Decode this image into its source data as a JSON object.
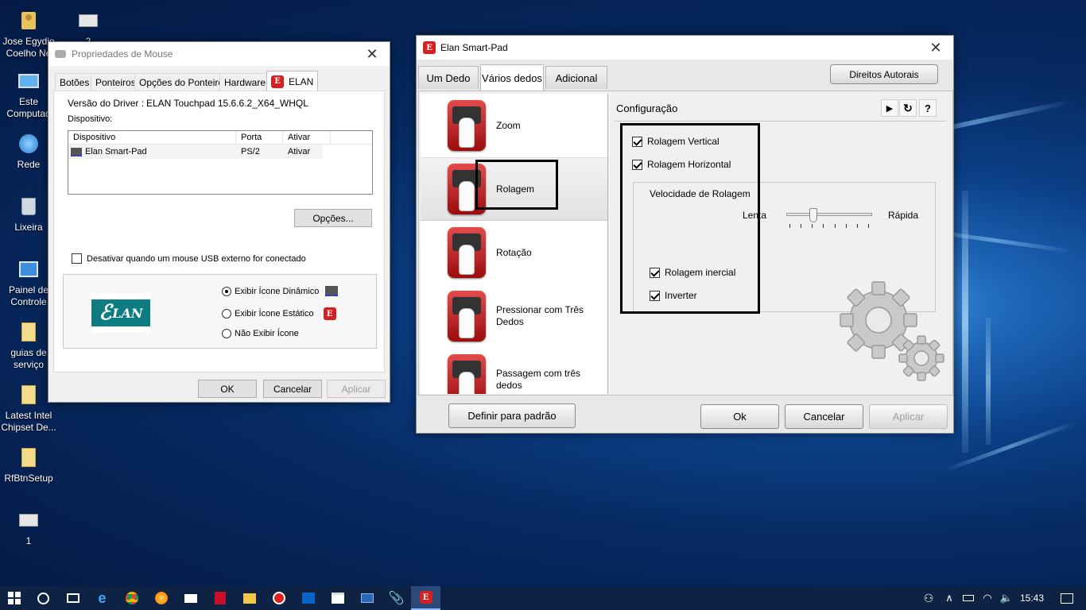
{
  "desktop": {
    "icons": [
      {
        "label": "Jose Egydio Coelho Ne",
        "icon": "user-folder-icon"
      },
      {
        "label": "2",
        "icon": "document-icon"
      },
      {
        "label": "Este Computad",
        "icon": "computer-icon"
      },
      {
        "label": "Rede",
        "icon": "network-icon"
      },
      {
        "label": "Lixeira",
        "icon": "recycle-bin-icon"
      },
      {
        "label": "Painel de Controle",
        "icon": "control-panel-icon"
      },
      {
        "label": "guias de serviço",
        "icon": "folder-icon"
      },
      {
        "label": "Latest Intel Chipset De...",
        "icon": "folder-icon"
      },
      {
        "label": "RfBtnSetup",
        "icon": "folder-icon"
      },
      {
        "label": "1",
        "icon": "document-icon"
      }
    ]
  },
  "mouse_props": {
    "title": "Propriedades de Mouse",
    "tabs": [
      "Botões",
      "Ponteiros",
      "Opções do Ponteiro",
      "Hardware",
      "ELAN"
    ],
    "active_tab": "ELAN",
    "driver_label": "Versão do Driver :",
    "driver_value": "ELAN Touchpad 15.6.6.2_X64_WHQL",
    "device_section": "Dispositivo:",
    "columns": [
      "Dispositivo",
      "Porta",
      "Ativar"
    ],
    "rows": [
      {
        "device": "Elan Smart-Pad",
        "port": "PS/2",
        "status": "Ativar"
      }
    ],
    "options_button": "Opções...",
    "disable_usb": {
      "label": "Desativar quando um mouse USB externo for conectado",
      "checked": false
    },
    "logo_text": "LAN",
    "icon_options": [
      {
        "label": "Exibir Ícone Dinâmico",
        "selected": true
      },
      {
        "label": "Exibir Ícone Estático",
        "selected": false
      },
      {
        "label": "Não Exibir Ícone",
        "selected": false
      }
    ],
    "ok": "OK",
    "cancel": "Cancelar",
    "apply": "Aplicar"
  },
  "elan": {
    "title": "Elan Smart-Pad",
    "tabs": [
      "Um Dedo",
      "Vários dedos",
      "Adicional"
    ],
    "active_tab": "Vários dedos",
    "copyright_button": "Direitos Autorais",
    "gestures": [
      "Zoom",
      "Rolagem",
      "Rotação",
      "Pressionar com Três Dedos",
      "Passagem com três dedos"
    ],
    "selected_gesture": "Rolagem",
    "config_title": "Configuração",
    "vertical_scroll": {
      "label": "Rolagem Vertical",
      "checked": true
    },
    "horizontal_scroll": {
      "label": "Rolagem Horizontal",
      "checked": true
    },
    "speed_group": "Velocidade de Rolagem",
    "slow": "Lenta",
    "fast": "Rápida",
    "speed_level": 0.3,
    "inertial": {
      "label": "Rolagem inercial",
      "checked": true
    },
    "invert": {
      "label": "Inverter",
      "checked": true
    },
    "default_button": "Definir para padrão",
    "ok": "Ok",
    "cancel": "Cancelar",
    "apply": "Aplicar",
    "accent": "#d42020"
  },
  "taskbar": {
    "time": "15:43",
    "apps": [
      "start-icon",
      "search-icon",
      "task-view-icon",
      "edge-icon",
      "chrome-icon",
      "firefox-icon",
      "mail-icon",
      "acrobat-icon",
      "explorer-icon",
      "app-icon",
      "outlook-icon",
      "store-icon",
      "powershell-icon",
      "attachment-icon",
      "elan-icon"
    ]
  }
}
